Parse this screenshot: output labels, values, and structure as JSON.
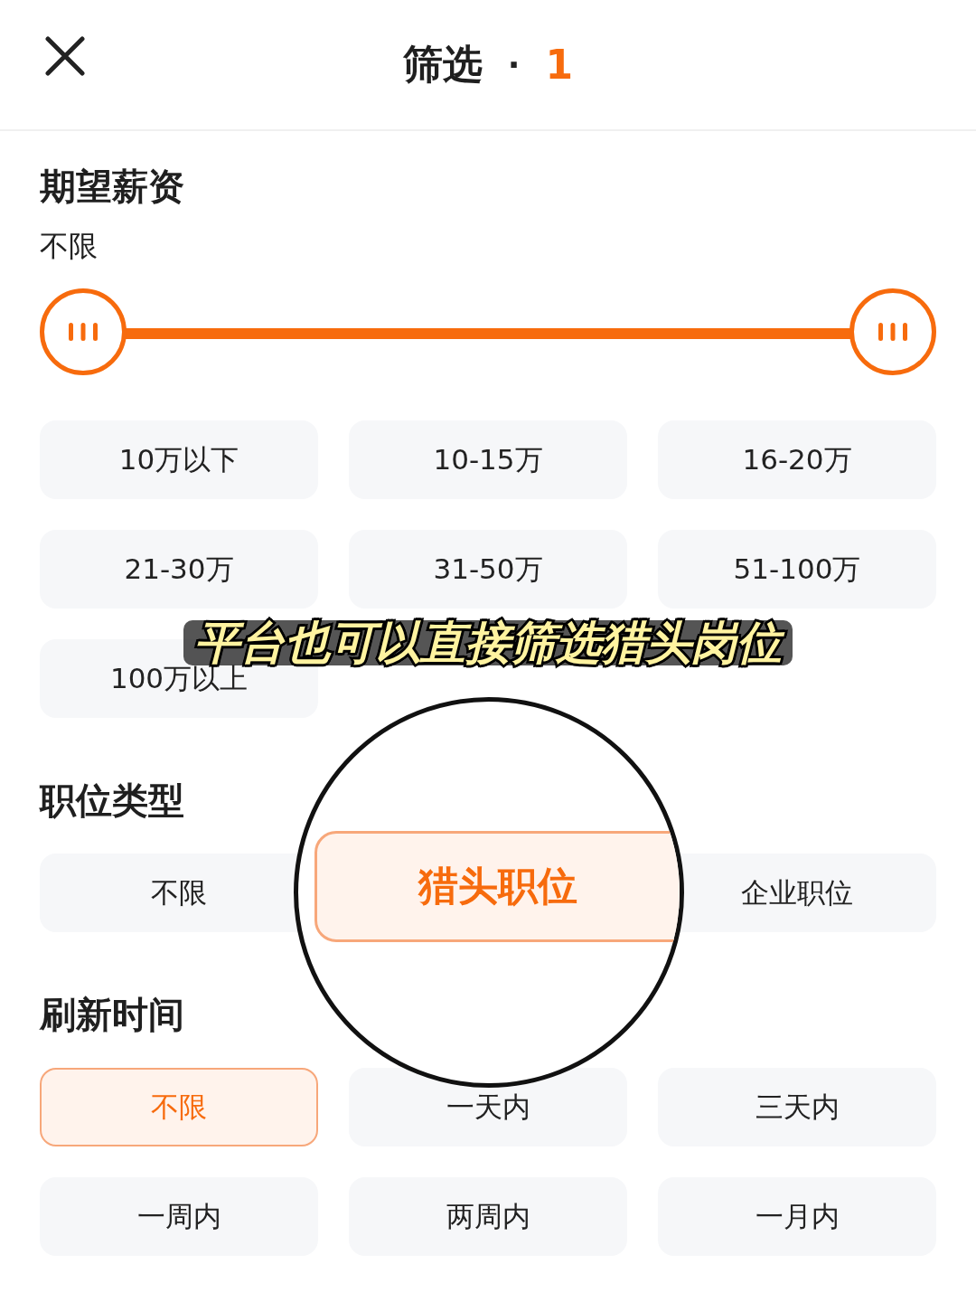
{
  "header": {
    "title": "筛选",
    "separator": "·",
    "count": "1"
  },
  "sections": [
    {
      "title": "期望薪资",
      "range_label": "不限",
      "thumbs": [
        {
          "level": 0
        },
        {
          "level": 1
        }
      ],
      "options": [
        {
          "label": "10万以下",
          "selected": false
        },
        {
          "label": "10-15万",
          "selected": false
        },
        {
          "label": "16-20万",
          "selected": false
        },
        {
          "label": "21-30万",
          "selected": false
        },
        {
          "label": "31-50万",
          "selected": false
        },
        {
          "label": "51-100万",
          "selected": false
        },
        {
          "label": "100万以上",
          "selected": false
        }
      ]
    },
    {
      "title": "职位类型",
      "options": [
        {
          "label": "不限",
          "selected": false
        },
        {
          "label": "猎头职位",
          "selected": true,
          "magnified": true
        },
        {
          "label": "企业职位",
          "selected": false
        }
      ]
    },
    {
      "title": "刷新时间",
      "options": [
        {
          "label": "不限",
          "selected": true
        },
        {
          "label": "一天内",
          "selected": false
        },
        {
          "label": "三天内",
          "selected": false
        },
        {
          "label": "一周内",
          "selected": false
        },
        {
          "label": "两周内",
          "selected": false
        },
        {
          "label": "一月内",
          "selected": false
        }
      ]
    }
  ],
  "caption": "平台也可以直接筛选猎头岗位"
}
